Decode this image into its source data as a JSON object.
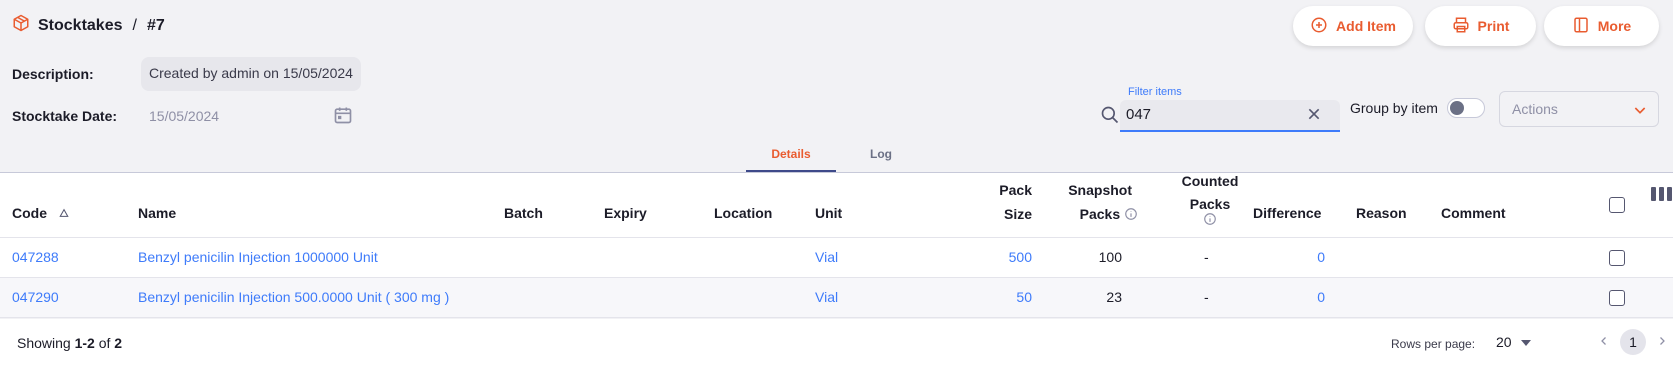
{
  "breadcrumb": {
    "root": "Stocktakes",
    "separator": "/",
    "current": "#7"
  },
  "toolbar": {
    "add_item": "Add Item",
    "print": "Print",
    "more": "More"
  },
  "form": {
    "description_label": "Description:",
    "description_value": "Created by admin on 15/05/2024",
    "date_label": "Stocktake Date:",
    "date_value": "15/05/2024"
  },
  "filter": {
    "label": "Filter items",
    "value": "047"
  },
  "group_by": {
    "label": "Group by item",
    "on": false
  },
  "actions": {
    "placeholder": "Actions"
  },
  "tabs": [
    {
      "label": "Details",
      "active": true
    },
    {
      "label": "Log",
      "active": false
    }
  ],
  "table": {
    "headers": {
      "code": "Code",
      "name": "Name",
      "batch": "Batch",
      "expiry": "Expiry",
      "location": "Location",
      "unit": "Unit",
      "pack_size_1": "Pack",
      "pack_size_2": "Size",
      "snapshot_1": "Snapshot",
      "snapshot_2": "Packs",
      "counted_1": "Counted",
      "counted_2": "Packs",
      "difference": "Difference",
      "reason": "Reason",
      "comment": "Comment"
    },
    "rows": [
      {
        "code": "047288",
        "name": "Benzyl penicilin Injection 1000000 Unit",
        "unit": "Vial",
        "pack_size": "500",
        "snapshot": "100",
        "counted": "-",
        "difference": "0"
      },
      {
        "code": "047290",
        "name": "Benzyl penicilin Injection 500.0000 Unit ( 300 mg )",
        "unit": "Vial",
        "pack_size": "50",
        "snapshot": "23",
        "counted": "-",
        "difference": "0"
      }
    ]
  },
  "footer": {
    "showing_prefix": "Showing",
    "range": "1-2",
    "of": "of",
    "total": "2",
    "rows_per_page_label": "Rows per page:",
    "rows_per_page_value": "20",
    "current_page": "1"
  },
  "colors": {
    "accent": "#e95c30",
    "link": "#3e7bfa",
    "background": "#f2f2f5"
  }
}
